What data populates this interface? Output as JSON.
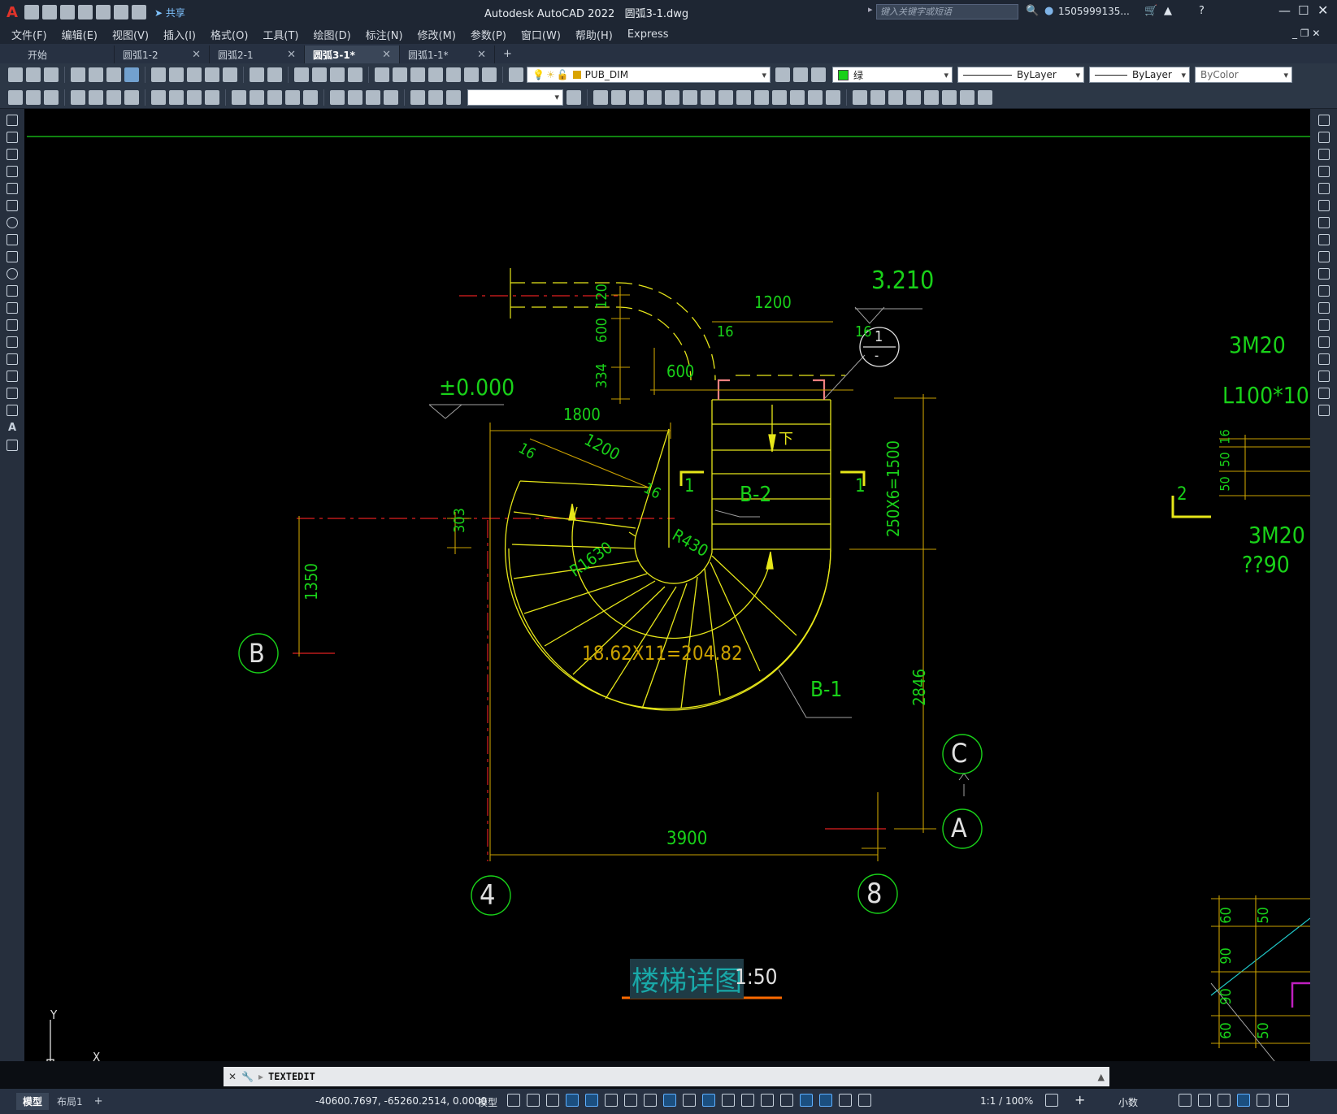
{
  "titlebar": {
    "app_title": "Autodesk AutoCAD 2022",
    "file_name": "圆弧3-1.dwg",
    "share_label": "共享",
    "search_placeholder": "键入关键字或短语",
    "user": "1505999135..."
  },
  "menu": [
    "文件(F)",
    "编辑(E)",
    "视图(V)",
    "插入(I)",
    "格式(O)",
    "工具(T)",
    "绘图(D)",
    "标注(N)",
    "修改(M)",
    "参数(P)",
    "窗口(W)",
    "帮助(H)",
    "Express"
  ],
  "tabs": [
    {
      "label": "开始",
      "active": false
    },
    {
      "label": "圆弧1-2",
      "active": false
    },
    {
      "label": "圆弧2-1",
      "active": false
    },
    {
      "label": "圆弧3-1*",
      "active": true
    },
    {
      "label": "圆弧1-1*",
      "active": false
    }
  ],
  "toolbar": {
    "layer": "PUB_DIM",
    "color": "绿",
    "linetype": "ByLayer",
    "lineweight": "ByLayer",
    "plotstyle": "ByColor"
  },
  "drawing": {
    "level_top": "3.210",
    "level_zero": "±0.000",
    "dims": {
      "d1200_top": "1200",
      "d120": "120",
      "d600_v": "600",
      "d334": "334",
      "d600_h": "600",
      "d16_a": "16",
      "d16_b": "16",
      "d1800": "1800",
      "d16_c": "16",
      "d1200_diag": "1200",
      "d16_d": "16",
      "d303": "303",
      "d1350": "1350",
      "r430": "R430",
      "r1630": "R1630",
      "steps_curve": "18.62X11=204.82",
      "steps_straight": "250X6=1500",
      "d2846": "2846",
      "d3900": "3900"
    },
    "labels": {
      "b2": "B-2",
      "b1": "B-1",
      "down": "下",
      "sec1_left": "1",
      "sec1_right": "1",
      "sec2": "2",
      "detail_num": "1",
      "detail_den": "-"
    },
    "axes": {
      "b": "B",
      "c": "C",
      "a": "A",
      "four": "4",
      "eight": "8"
    },
    "right_notes": {
      "m20_top": "3M20",
      "l100": "L100*10",
      "d16": "16",
      "d50": "50",
      "d50b": "50",
      "m20_mid": "3M20",
      "q90": "??90",
      "bottom_dims": [
        "60",
        "50",
        "90",
        "90",
        "60",
        "50"
      ]
    },
    "title": "楼梯详图",
    "scale": "1:50",
    "ucs_x": "X",
    "ucs_y": "Y"
  },
  "command": {
    "text": "TEXTEDIT"
  },
  "status": {
    "model_tab": "模型",
    "layout_tab": "布局1",
    "coords": "-40600.7697, -65260.2514, 0.0000",
    "space": "模型",
    "scale": "1:1 / 100%",
    "units": "小数"
  },
  "colors": {
    "green": "#19d119",
    "yellow": "#e6e619",
    "dim": "#c9a000",
    "red": "#e02020",
    "cyan": "#20c8c8",
    "magenta": "#c020c0"
  }
}
